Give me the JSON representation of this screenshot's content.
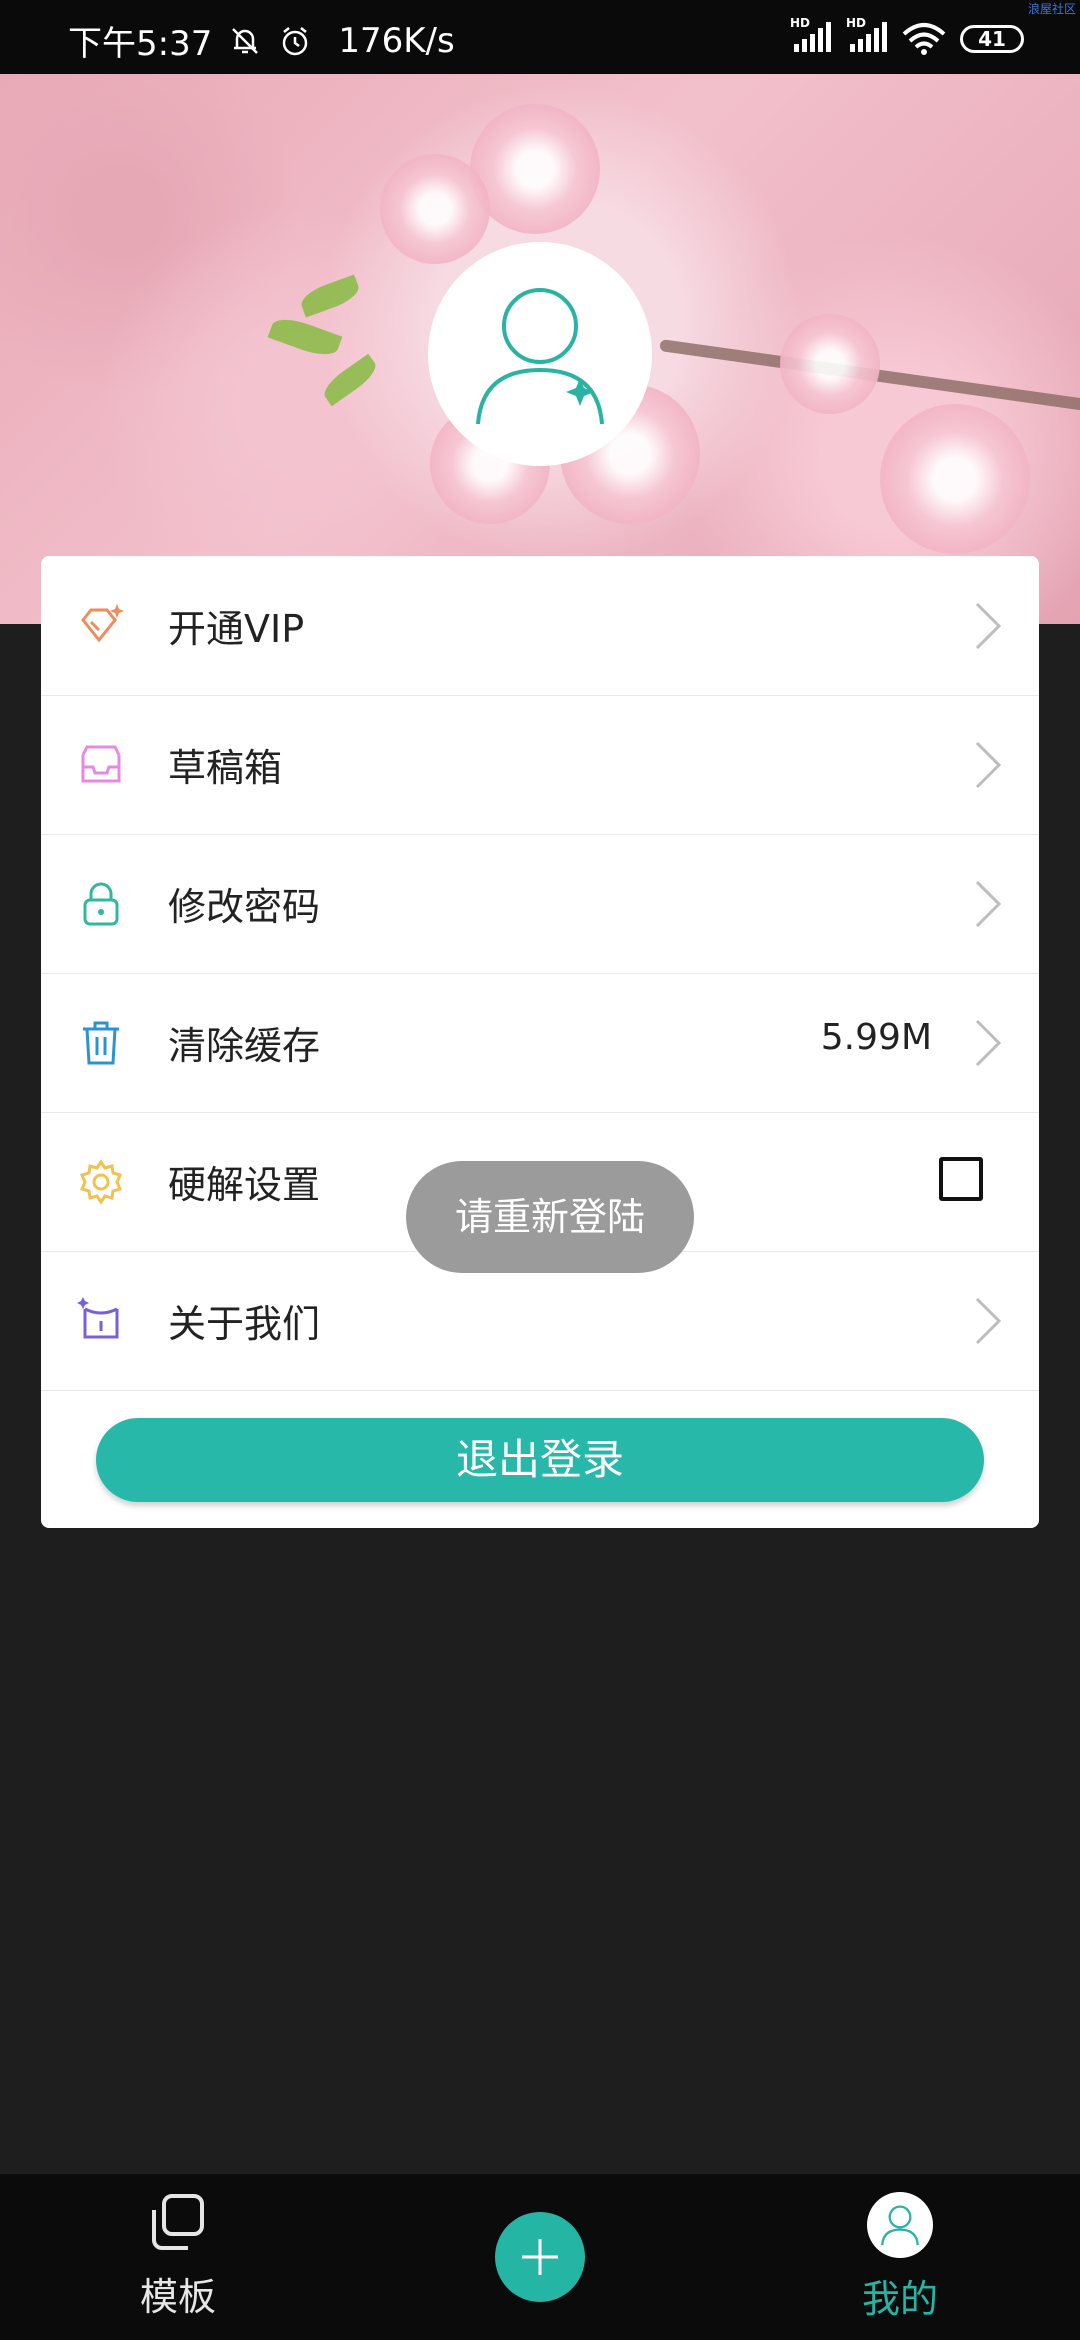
{
  "status_bar": {
    "time": "下午5:37",
    "speed": "176K/s",
    "signal_hd_1": "HD",
    "signal_hd_2": "HD",
    "battery": "41",
    "watermark": "浪屋社区"
  },
  "menu": {
    "items": [
      {
        "label": "开通VIP",
        "icon": "diamond-icon",
        "color": "#f08b5a"
      },
      {
        "label": "草稿箱",
        "icon": "inbox-icon",
        "color": "#e58ae0"
      },
      {
        "label": "修改密码",
        "icon": "lock-icon",
        "color": "#2fb89e"
      },
      {
        "label": "清除缓存",
        "icon": "trash-icon",
        "color": "#2a93d5",
        "value": "5.99M"
      },
      {
        "label": "硬解设置",
        "icon": "gear-icon",
        "color": "#f2c14e",
        "checked": false
      },
      {
        "label": "关于我们",
        "icon": "info-icon",
        "color": "#7b5fd9"
      }
    ],
    "logout_label": "退出登录"
  },
  "toast": "请重新登陆",
  "bottom_nav": {
    "templates_label": "模板",
    "mine_label": "我的",
    "active_color": "#25b5a5"
  }
}
